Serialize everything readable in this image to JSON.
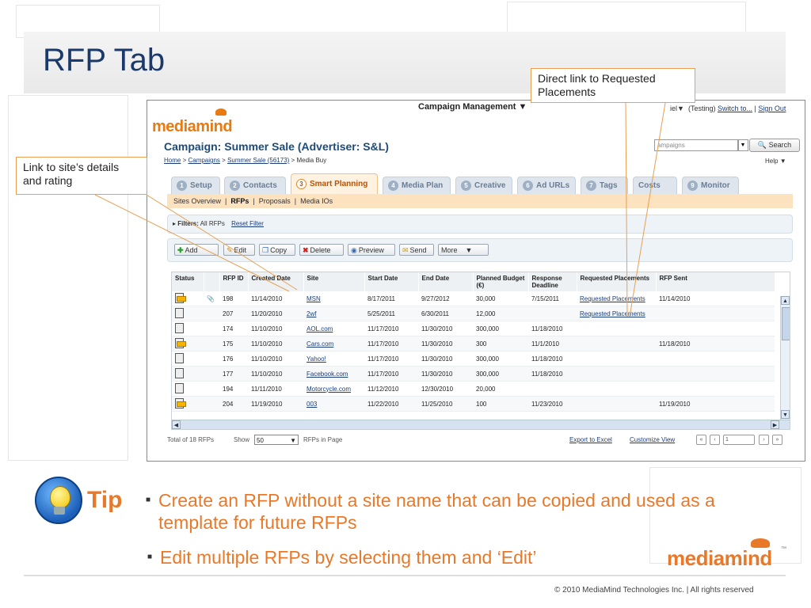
{
  "slide": {
    "title": "RFP Tab",
    "copyright": "© 2010 MediaMind Technologies Inc. | All rights reserved",
    "logo": "mediamind",
    "logo_tm": "™"
  },
  "callouts": {
    "direct_link": "Direct link to Requested Placements",
    "site_link": "Link to site’s details and rating"
  },
  "tip": {
    "label": "Tip",
    "bullets": [
      "Create an RFP without a site name that can be copied and used as a template for future RFPs",
      "Edit multiple RFPs by selecting them and ‘Edit’"
    ]
  },
  "app": {
    "menu": "Campaign Management",
    "top_fragment": "iel",
    "testing": "(Testing)",
    "switch_to": "Switch to...",
    "sign_out": "Sign Out",
    "logo": "mediamind",
    "campaign_title": "Campaign: Summer Sale (Advertiser: S&L)",
    "breadcrumb": {
      "home": "Home",
      "campaigns": "Campaigns",
      "campaign": "Summer Sale (56173)",
      "current": "Media Buy"
    },
    "search": {
      "placeholder": "ampaigns",
      "button": "Search"
    },
    "help": "Help",
    "tabs": [
      {
        "num": "1",
        "label": "Setup"
      },
      {
        "num": "2",
        "label": "Contacts"
      },
      {
        "num": "3",
        "label": "Smart Planning"
      },
      {
        "num": "4",
        "label": "Media Plan"
      },
      {
        "num": "5",
        "label": "Creative"
      },
      {
        "num": "6",
        "label": "Ad URLs"
      },
      {
        "num": "7",
        "label": "Tags"
      },
      {
        "num": "",
        "label": "Costs"
      },
      {
        "num": "9",
        "label": "Monitor"
      }
    ],
    "subnav": [
      "Sites Overview",
      "RFPs",
      "Proposals",
      "Media IOs"
    ],
    "filters": {
      "label": "Filters:",
      "value": "All RFPs",
      "reset": "Reset Filter"
    },
    "actions": {
      "add": "Add",
      "edit": "Edit",
      "copy": "Copy",
      "delete": "Delete",
      "preview": "Preview",
      "send": "Send",
      "more": "More"
    },
    "table": {
      "headers": [
        "Status",
        "",
        "RFP ID",
        "Created Date",
        "Site",
        "Start Date",
        "End Date",
        "Planned Budget (€)",
        "Response Deadline",
        "Requested Placements",
        "RFP Sent"
      ],
      "rows": [
        {
          "id": "198",
          "created": "11/14/2010",
          "site": "MSN",
          "start": "8/17/2011",
          "end": "9/27/2012",
          "budget": "30,000",
          "deadline": "7/15/2011",
          "placements": "Requested Placements",
          "sent": "11/14/2010"
        },
        {
          "id": "207",
          "created": "11/20/2010",
          "site": "2wf",
          "start": "5/25/2011",
          "end": "6/30/2011",
          "budget": "12,000",
          "deadline": "",
          "placements": "Requested Placements",
          "sent": ""
        },
        {
          "id": "174",
          "created": "11/10/2010",
          "site": "AOL.com",
          "start": "11/17/2010",
          "end": "11/30/2010",
          "budget": "300,000",
          "deadline": "11/18/2010",
          "placements": "",
          "sent": ""
        },
        {
          "id": "175",
          "created": "11/10/2010",
          "site": "Cars.com",
          "start": "11/17/2010",
          "end": "11/30/2010",
          "budget": "300",
          "deadline": "11/1/2010",
          "placements": "",
          "sent": "11/18/2010"
        },
        {
          "id": "176",
          "created": "11/10/2010",
          "site": "Yahoo!",
          "start": "11/17/2010",
          "end": "11/30/2010",
          "budget": "300,000",
          "deadline": "11/18/2010",
          "placements": "",
          "sent": ""
        },
        {
          "id": "177",
          "created": "11/10/2010",
          "site": "Facebook.com",
          "start": "11/17/2010",
          "end": "11/30/2010",
          "budget": "300,000",
          "deadline": "11/18/2010",
          "placements": "",
          "sent": ""
        },
        {
          "id": "194",
          "created": "11/11/2010",
          "site": "Motorcycle.com",
          "start": "11/12/2010",
          "end": "12/30/2010",
          "budget": "20,000",
          "deadline": "",
          "placements": "",
          "sent": ""
        },
        {
          "id": "204",
          "created": "11/19/2010",
          "site": "003",
          "start": "11/22/2010",
          "end": "11/25/2010",
          "budget": "100",
          "deadline": "11/23/2010",
          "placements": "",
          "sent": "11/19/2010"
        }
      ]
    },
    "footer": {
      "total": "Total of 18 RFPs",
      "show": "Show",
      "page_size": "50",
      "rfps_in_page": "RFPs in Page",
      "export": "Export to Excel",
      "customize": "Customize View",
      "page": "1"
    }
  }
}
